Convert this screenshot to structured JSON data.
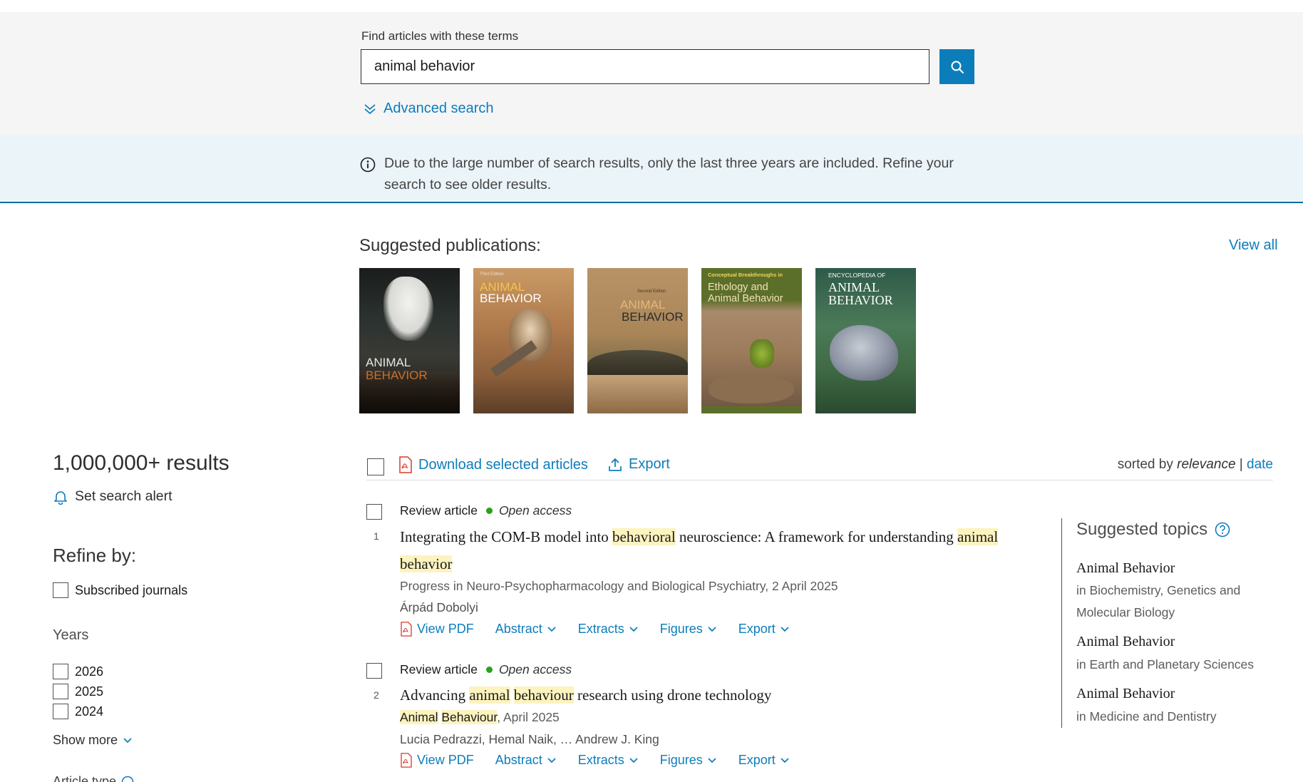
{
  "search": {
    "label": "Find articles with these terms",
    "value": "animal behavior",
    "advanced": "Advanced search"
  },
  "notice": {
    "text": "Due to the large number of search results, only the last three years are included. Refine your search to see older results."
  },
  "suggested": {
    "title": "Suggested publications:",
    "view_all": "View all",
    "covers": [
      {
        "line1": "ANIMAL",
        "line2": "BEHAVIOR",
        "tag": ""
      },
      {
        "line1": "ANIMAL",
        "line2": "BEHAVIOR",
        "tag": "Third Edition"
      },
      {
        "line1": "ANIMAL",
        "line2": "BEHAVIOR",
        "tag": "Second Edition"
      },
      {
        "line1": "Ethology and",
        "line2": "Animal Behavior",
        "tag": "Conceptual Breakthroughs in"
      },
      {
        "line1": "ANIMAL",
        "line2": "BEHAVIOR",
        "tag": "ENCYCLOPEDIA OF"
      }
    ]
  },
  "sidebar": {
    "results_count": "1,000,000+ results",
    "set_alert": "Set search alert",
    "refine_title": "Refine by:",
    "subscribed": "Subscribed journals",
    "years_title": "Years",
    "years": [
      "2026",
      "2025",
      "2024"
    ],
    "show_more": "Show more",
    "article_type": "Article type"
  },
  "toolbar": {
    "download": "Download selected articles",
    "export": "Export",
    "sorted_by": "sorted by",
    "relevance": "relevance",
    "separator": "|",
    "date": "date"
  },
  "results": [
    {
      "number": "1",
      "type": "Review article",
      "access": "Open access",
      "title_parts": [
        {
          "t": "Integrating the COM-B model into ",
          "h": false
        },
        {
          "t": "behavioral",
          "h": true
        },
        {
          "t": " neuroscience: A framework for understanding ",
          "h": false
        },
        {
          "t": "animal",
          "h": true
        },
        {
          "t": " ",
          "h": false
        },
        {
          "t": "behavior",
          "h": true
        }
      ],
      "source": "Progress in Neuro-Psychopharmacology and Biological Psychiatry, 2 April 2025",
      "authors": "Árpád Dobolyi",
      "actions": {
        "pdf": "View PDF",
        "abstract": "Abstract",
        "extracts": "Extracts",
        "figures": "Figures",
        "export": "Export"
      }
    },
    {
      "number": "2",
      "type": "Review article",
      "access": "Open access",
      "title_parts": [
        {
          "t": "Advancing ",
          "h": false
        },
        {
          "t": "animal",
          "h": true
        },
        {
          "t": " ",
          "h": false
        },
        {
          "t": "behaviour",
          "h": true
        },
        {
          "t": " research using drone technology",
          "h": false
        }
      ],
      "source_hl_1": "Animal",
      "source_hl_2": "Behaviour",
      "source_rest": ", April 2025",
      "authors": "Lucia Pedrazzi, Hemal Naik, … Andrew J. King",
      "actions": {
        "pdf": "View PDF",
        "abstract": "Abstract",
        "extracts": "Extracts",
        "figures": "Figures",
        "export": "Export"
      }
    }
  ],
  "topics": {
    "title": "Suggested topics",
    "items": [
      {
        "name": "Animal Behavior",
        "sub": "in Biochemistry, Genetics and Molecular Biology"
      },
      {
        "name": "Animal Behavior",
        "sub": "in Earth and Planetary Sciences"
      },
      {
        "name": "Animal Behavior",
        "sub": "in Medicine and Dentistry"
      }
    ]
  },
  "colors": {
    "link": "#0c7dbb",
    "highlight": "#fcf3bf",
    "open_access_dot": "#29a21b",
    "notice_bg": "#ebf4f9"
  }
}
